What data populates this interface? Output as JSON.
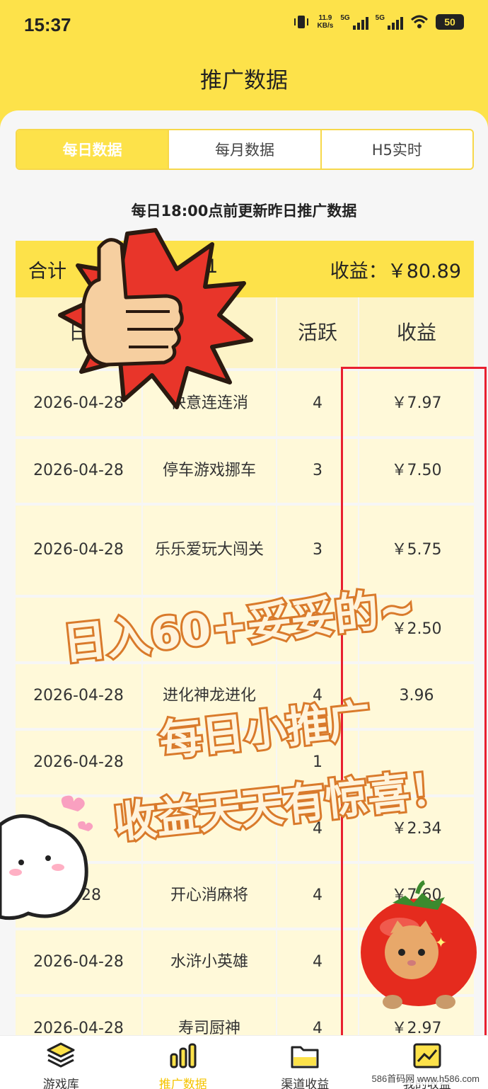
{
  "status": {
    "time": "15:37",
    "speed_value": "11.9",
    "speed_unit": "KB/s",
    "sim1": "5G",
    "sim2": "5G",
    "battery": "50"
  },
  "header": {
    "title": "推广数据"
  },
  "tabs": [
    {
      "label": "每日数据",
      "active": true
    },
    {
      "label": "每月数据",
      "active": false
    },
    {
      "label": "H5实时",
      "active": false
    }
  ],
  "update_note": "每日18:00点前更新昨日推广数据",
  "summary": {
    "total_label": "合计",
    "total_partial": "51",
    "income_text": "收益：￥80.89"
  },
  "table": {
    "headers": [
      "日",
      "戏",
      "活跃",
      "收益"
    ],
    "rows": [
      {
        "date": "2026-04-28",
        "game": "快意连连消",
        "active": "4",
        "income": "￥7.97"
      },
      {
        "date": "2026-04-28",
        "game": "停车游戏挪车",
        "active": "3",
        "income": "￥7.50"
      },
      {
        "date": "2026-04-28",
        "game": "乐乐爱玩大闯关",
        "active": "3",
        "income": "￥5.75"
      },
      {
        "date": "",
        "game": "",
        "active": "3",
        "income": "￥2.50"
      },
      {
        "date": "2026-04-28",
        "game": "进化神龙进化",
        "active": "4",
        "income": "3.96"
      },
      {
        "date": "2026-04-28",
        "game": "",
        "active": "1",
        "income": ""
      },
      {
        "date": "",
        "game": "",
        "active": "4",
        "income": "￥2.34"
      },
      {
        "date": "04-28",
        "game": "开心消麻将",
        "active": "4",
        "income": "￥7.60"
      },
      {
        "date": "2026-04-28",
        "game": "水浒小英雄",
        "active": "4",
        "income": ""
      },
      {
        "date": "2026-04-28",
        "game": "寿司厨神",
        "active": "4",
        "income": "￥2.97"
      }
    ]
  },
  "overlay_text": {
    "line1": "日入60+妥妥的~",
    "line2": "每日小推广",
    "line3": "收益天天有惊喜！"
  },
  "nav": [
    {
      "label": "游戏库",
      "icon": "layers-icon",
      "active": false
    },
    {
      "label": "推广数据",
      "icon": "bar-chart-icon",
      "active": true
    },
    {
      "label": "渠道收益",
      "icon": "folder-icon",
      "active": false
    },
    {
      "label": "我的收益",
      "icon": "trend-chart-icon",
      "active": false
    }
  ],
  "watermark": "586首码网 www.h586.com",
  "colors": {
    "accent": "#fde24a",
    "highlight": "#e82030",
    "row": "#fff9d9"
  }
}
